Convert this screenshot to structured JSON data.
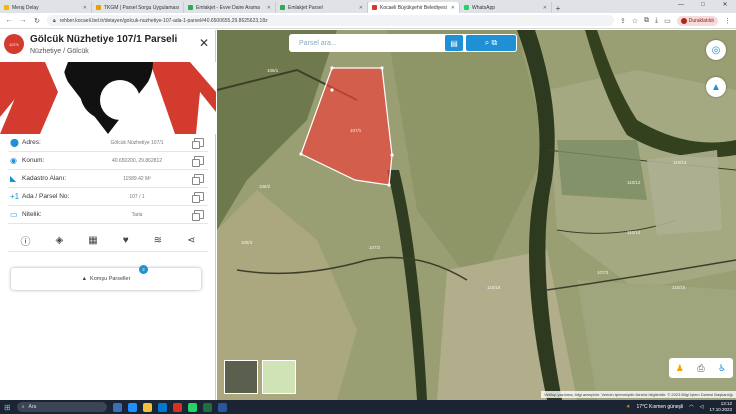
{
  "browser": {
    "tabs": [
      {
        "label": "Meraj Delay",
        "color": "#f2b705",
        "active": false
      },
      {
        "label": "TKGM | Parsel Sorgu Uygulaması",
        "color": "#e8a000",
        "active": false
      },
      {
        "label": "Emlakjet - Evve Daire Arama",
        "color": "#34a853",
        "active": false
      },
      {
        "label": "Emlakjet Parsel",
        "color": "#34a853",
        "active": false
      },
      {
        "label": "Kocaeli Büyükşehir Belediyesi",
        "color": "#d23b2e",
        "active": true
      },
      {
        "label": "WhatsApp",
        "color": "#25d366",
        "active": false
      }
    ],
    "new_tab_symbol": "+",
    "url": "rehber.kocaeli.bel.tr/detayen/golcuk-nuzhetiye-107-ada-1-parsel#40.6500655,29.8625623,18z",
    "profile_label": "Duraklatıldı",
    "window_controls": [
      "—",
      "□",
      "✕"
    ]
  },
  "panel": {
    "badge": "107/1",
    "title": "Gölcük Nüzhetiye 107/1 Parseli",
    "subtitle": "Nüzhetiye / Gölcük",
    "close_symbol": "✕",
    "properties": [
      {
        "icon": "location-pin-icon",
        "label": "Adres:",
        "value": "Gölcük Nüzhetiye 107/1"
      },
      {
        "icon": "target-icon",
        "label": "Konum:",
        "value": "40.650200, 29.862812"
      },
      {
        "icon": "area-icon",
        "label": "Kadastro Alanı:",
        "value": "11589.42 M²"
      },
      {
        "icon": "plus-one-icon",
        "label": "Ada / Parsel No:",
        "value": "107 / 1"
      },
      {
        "icon": "tag-icon",
        "label": "Nitelik:",
        "value": "Tarla"
      }
    ],
    "komsu": {
      "label": "Komşu Parseller",
      "count": "2"
    }
  },
  "map": {
    "search_placeholder": "Parsel ara...",
    "parcel_label": "107/1",
    "labels": [
      {
        "t": "107/1"
      },
      {
        "t": "106/1"
      },
      {
        "t": "106/2"
      },
      {
        "t": "108/3"
      },
      {
        "t": "107/2"
      },
      {
        "t": "110/13"
      },
      {
        "t": "110/14"
      },
      {
        "t": "110/16"
      },
      {
        "t": "110/12"
      },
      {
        "t": "107/3"
      },
      {
        "t": "110/15"
      }
    ],
    "attribution": "Verilop yazılıma; bilgi amaçlıdır. Verinin işlenmişidir ikincisi bilgileridir. © 2023 Bilgi İşlem Dairesi Başkanlığı"
  },
  "taskbar": {
    "search_label": "Ara",
    "weather": "17°C  Kısmen güneşli",
    "time": "13:12",
    "date": "17.10.2023"
  }
}
